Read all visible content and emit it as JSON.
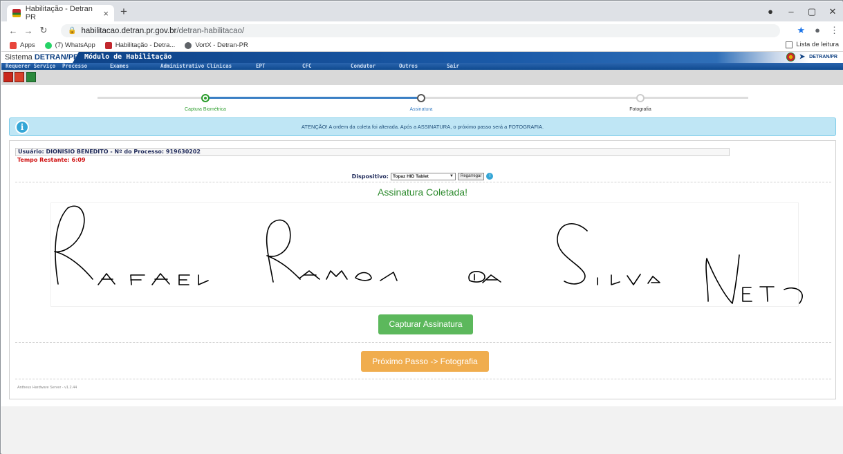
{
  "browser": {
    "tab_title": "Habilitação - Detran PR",
    "tab_close": "×",
    "new_tab": "+",
    "window_controls": [
      "●",
      "–",
      "▢",
      "✕"
    ],
    "url_host": "habilitacao.detran.pr.gov.br",
    "url_path": "/detran-habilitacao/",
    "bookmarks": [
      {
        "label": "Apps",
        "icon": "apps-icon",
        "color": "#e8453c"
      },
      {
        "label": "(7) WhatsApp",
        "icon": "whatsapp-icon",
        "color": "#25d366"
      },
      {
        "label": "Habilitação - Detra...",
        "icon": "detran-icon",
        "color": "#c1272d"
      },
      {
        "label": "VortX - Detran-PR",
        "icon": "globe-icon",
        "color": "#5f6368"
      }
    ],
    "reading_list": "Lista de leitura"
  },
  "header": {
    "system_prefix": "Sistema",
    "system_name": "DETRAN/PR",
    "module": "Módulo de Habilitação",
    "logo_text": "DETRAN/PR"
  },
  "menu": [
    "Requerer Serviço",
    "Processo",
    "Exames",
    "Administrativo",
    "Clínicas",
    "EPT",
    "CFC",
    "Condutor",
    "Outros",
    "Sair"
  ],
  "steps": [
    {
      "label": "Captura Biométrica",
      "state": "done"
    },
    {
      "label": "Assinatura",
      "state": "current"
    },
    {
      "label": "Fotografia",
      "state": "pending"
    }
  ],
  "colors": {
    "done": "#2e9e2e",
    "current": "#3a7fc4",
    "pending": "#cccccc",
    "accent_green": "#5cb85c",
    "accent_orange": "#f0ad4e",
    "error_red": "#d01010"
  },
  "alert": {
    "icon": "info-icon",
    "text": "ATENÇÃO! A ordem da coleta foi alterada. Após a ASSINATURA, o próximo passo será a FOTOGRAFIA."
  },
  "process": {
    "user_line": "Usuário: DIONISIO BENEDITO - Nº do Processo: 919630202",
    "timer": "Tempo Restante: 6:09"
  },
  "device": {
    "label": "Dispositivo:",
    "selected": "Topaz HID Tablet",
    "reload": "Regarregar"
  },
  "signature": {
    "status": "Assinatura Coletada!",
    "capture_button": "Capturar Assinatura",
    "next_button": "Próximo Passo -> Fotografia"
  },
  "footer": "Antheus Hardware Server - v1.2.44"
}
